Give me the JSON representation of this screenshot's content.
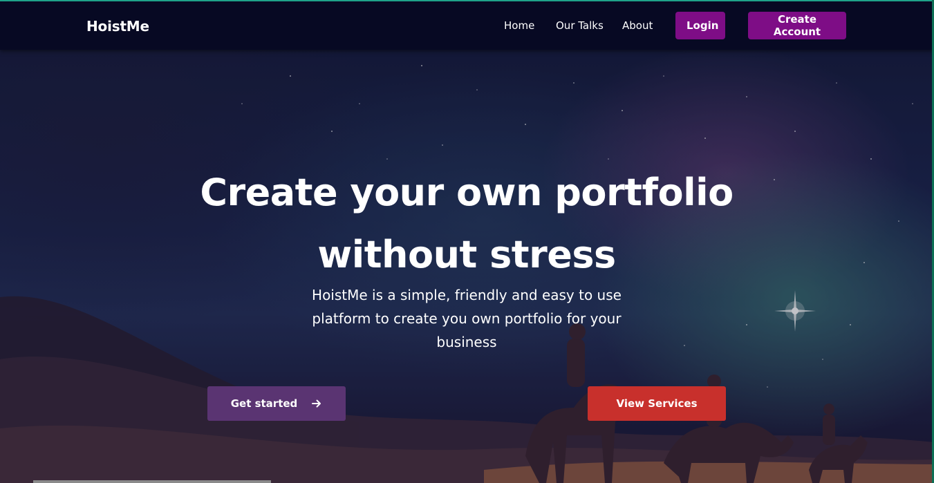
{
  "nav": {
    "brand": "HoistMe",
    "links": [
      "Home",
      "Our Talks",
      "About"
    ],
    "login_label": "Login",
    "create_account_label": "Create Account"
  },
  "hero": {
    "title_line1": "Create your own portfolio",
    "title_line2": "without stress",
    "subtitle_line1": "HoistMe is a simple, friendly and easy to use",
    "subtitle_line2": "platform to create you own portfolio for your",
    "subtitle_line3": "business",
    "get_started_label": "Get started",
    "get_started_icon": "arrow-right-icon",
    "view_services_label": "View Services"
  },
  "colors": {
    "navbar_bg": "#070923",
    "nav_button": "#7e0d86",
    "get_started_button": "#5a3472",
    "view_services_button": "#c8302c"
  }
}
